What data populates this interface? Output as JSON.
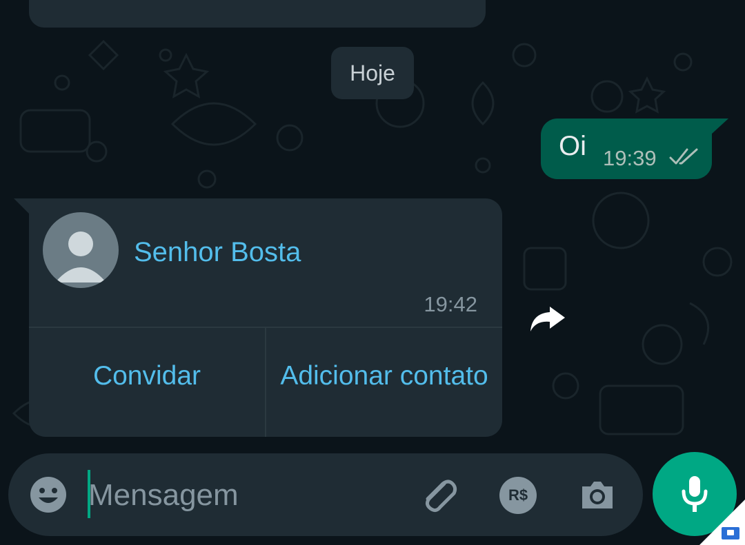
{
  "chat": {
    "date_chip": "Hoje",
    "outgoing_message": {
      "text": "Oi",
      "time": "19:39",
      "status": "double-check-read"
    },
    "contact_card": {
      "name": "Senhor Bosta",
      "time": "19:42",
      "invite_label": "Convidar",
      "add_contact_label": "Adicionar contato"
    }
  },
  "composer": {
    "placeholder": "Mensagem",
    "payment_label": "R$"
  },
  "icons": {
    "emoji": "emoji-icon",
    "attach": "paperclip-icon",
    "payment": "payment-icon",
    "camera": "camera-icon",
    "mic": "microphone-icon",
    "forward": "forward-icon",
    "avatar": "default-avatar-icon"
  },
  "colors": {
    "background": "#0b141a",
    "bubble_incoming": "#1f2c34",
    "bubble_outgoing": "#005c4b",
    "accent": "#00a884",
    "link_blue": "#53bdeb"
  }
}
